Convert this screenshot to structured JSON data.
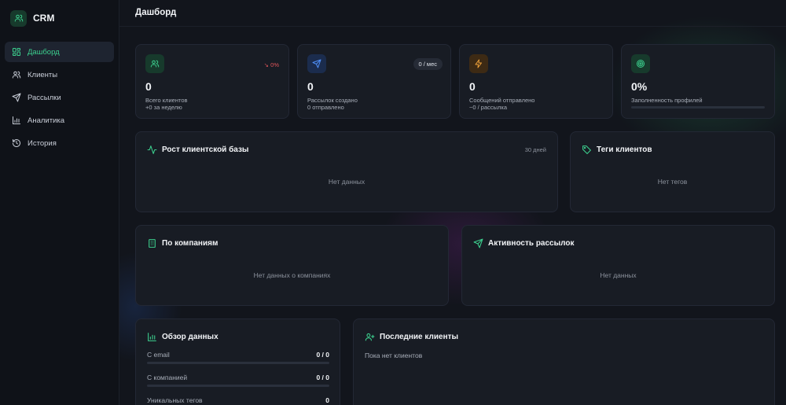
{
  "app": {
    "name": "CRM"
  },
  "sidebar": {
    "items": [
      {
        "label": "Дашборд",
        "icon": "dashboard-icon",
        "active": true
      },
      {
        "label": "Клиенты",
        "icon": "users-icon"
      },
      {
        "label": "Рассылки",
        "icon": "send-icon"
      },
      {
        "label": "Аналитика",
        "icon": "bar-chart-icon"
      },
      {
        "label": "История",
        "icon": "history-icon"
      }
    ]
  },
  "header": {
    "title": "Дашборд"
  },
  "stats": [
    {
      "value": "0",
      "label": "Всего клиентов",
      "sub": "+0 за неделю",
      "badge": "↘ 0%",
      "icon": "users-icon",
      "accent": "#3ccf8e"
    },
    {
      "value": "0",
      "label": "Рассылок создано",
      "sub": "0 отправлено",
      "badge": "0 / мес",
      "icon": "send-icon",
      "accent": "#4f8ff7"
    },
    {
      "value": "0",
      "label": "Сообщений отправлено",
      "sub": "~0 / рассылка",
      "icon": "lightning-icon",
      "accent": "#f0a23a"
    },
    {
      "value": "0%",
      "label": "Заполненность профилей",
      "progress": 0,
      "icon": "target-icon",
      "accent": "#3ccf8e"
    }
  ],
  "panels": {
    "growth": {
      "title": "Рост клиентской базы",
      "period": "30 дней",
      "empty": "Нет данных"
    },
    "tags": {
      "title": "Теги клиентов",
      "empty": "Нет тегов"
    },
    "companies": {
      "title": "По компаниям",
      "empty": "Нет данных о компаниях"
    },
    "mailing_activity": {
      "title": "Активность рассылок",
      "empty": "Нет данных"
    },
    "overview": {
      "title": "Обзор данных",
      "rows": [
        {
          "label": "С email",
          "value": "0 / 0"
        },
        {
          "label": "С компанией",
          "value": "0 / 0"
        },
        {
          "label": "Уникальных тегов",
          "value": "0"
        }
      ]
    },
    "recent": {
      "title": "Последние клиенты",
      "empty": "Пока нет клиентов"
    }
  },
  "colors": {
    "accent": "#3ccf8e",
    "danger": "#e0555a",
    "background": "#12151c",
    "card": "#181c24"
  }
}
